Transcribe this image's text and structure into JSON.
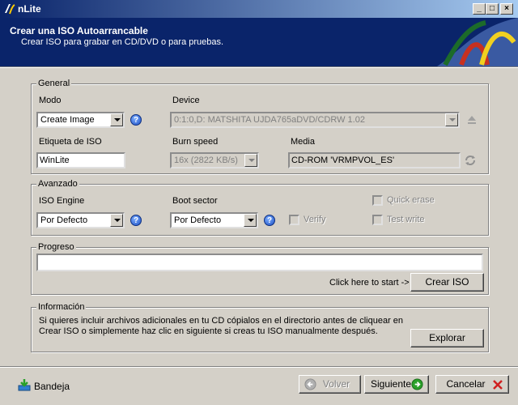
{
  "window": {
    "title": "nLite"
  },
  "header": {
    "title": "Crear una ISO Autoarrancable",
    "subtitle": "Crear ISO para grabar en CD/DVD o para pruebas."
  },
  "general": {
    "group_label": "General",
    "modo_label": "Modo",
    "modo_value": "Create Image",
    "device_label": "Device",
    "device_value": "0:1:0,D: MATSHITA UJDA765aDVD/CDRW 1.02",
    "etiqueta_label": "Etiqueta de ISO",
    "etiqueta_value": "WinLite",
    "burn_speed_label": "Burn speed",
    "burn_speed_value": "16x (2822 KB/s)",
    "media_label": "Media",
    "media_value": "CD-ROM 'VRMPVOL_ES'"
  },
  "avanzado": {
    "group_label": "Avanzado",
    "iso_engine_label": "ISO Engine",
    "iso_engine_value": "Por Defecto",
    "boot_sector_label": "Boot sector",
    "boot_sector_value": "Por Defecto",
    "verify_label": "Verify",
    "quick_erase_label": "Quick erase",
    "test_write_label": "Test write"
  },
  "progreso": {
    "group_label": "Progreso",
    "hint": "Click here to start ->",
    "crear_iso_label": "Crear ISO"
  },
  "informacion": {
    "group_label": "Información",
    "text_line1": "Si quieres incluir archivos adicionales en tu CD cópialos en el directorio antes de cliquear en",
    "text_line2": "Crear ISO o simplemente haz clic en siguiente si creas tu ISO manualmente después.",
    "explorar_label": "Explorar"
  },
  "footer": {
    "bandeja_label": "Bandeja",
    "volver_label": "Volver",
    "siguiente_label": "Siguiente",
    "cancelar_label": "Cancelar"
  },
  "colors": {
    "header_bg": "#0a246a",
    "window_bg": "#d4d0c8"
  }
}
